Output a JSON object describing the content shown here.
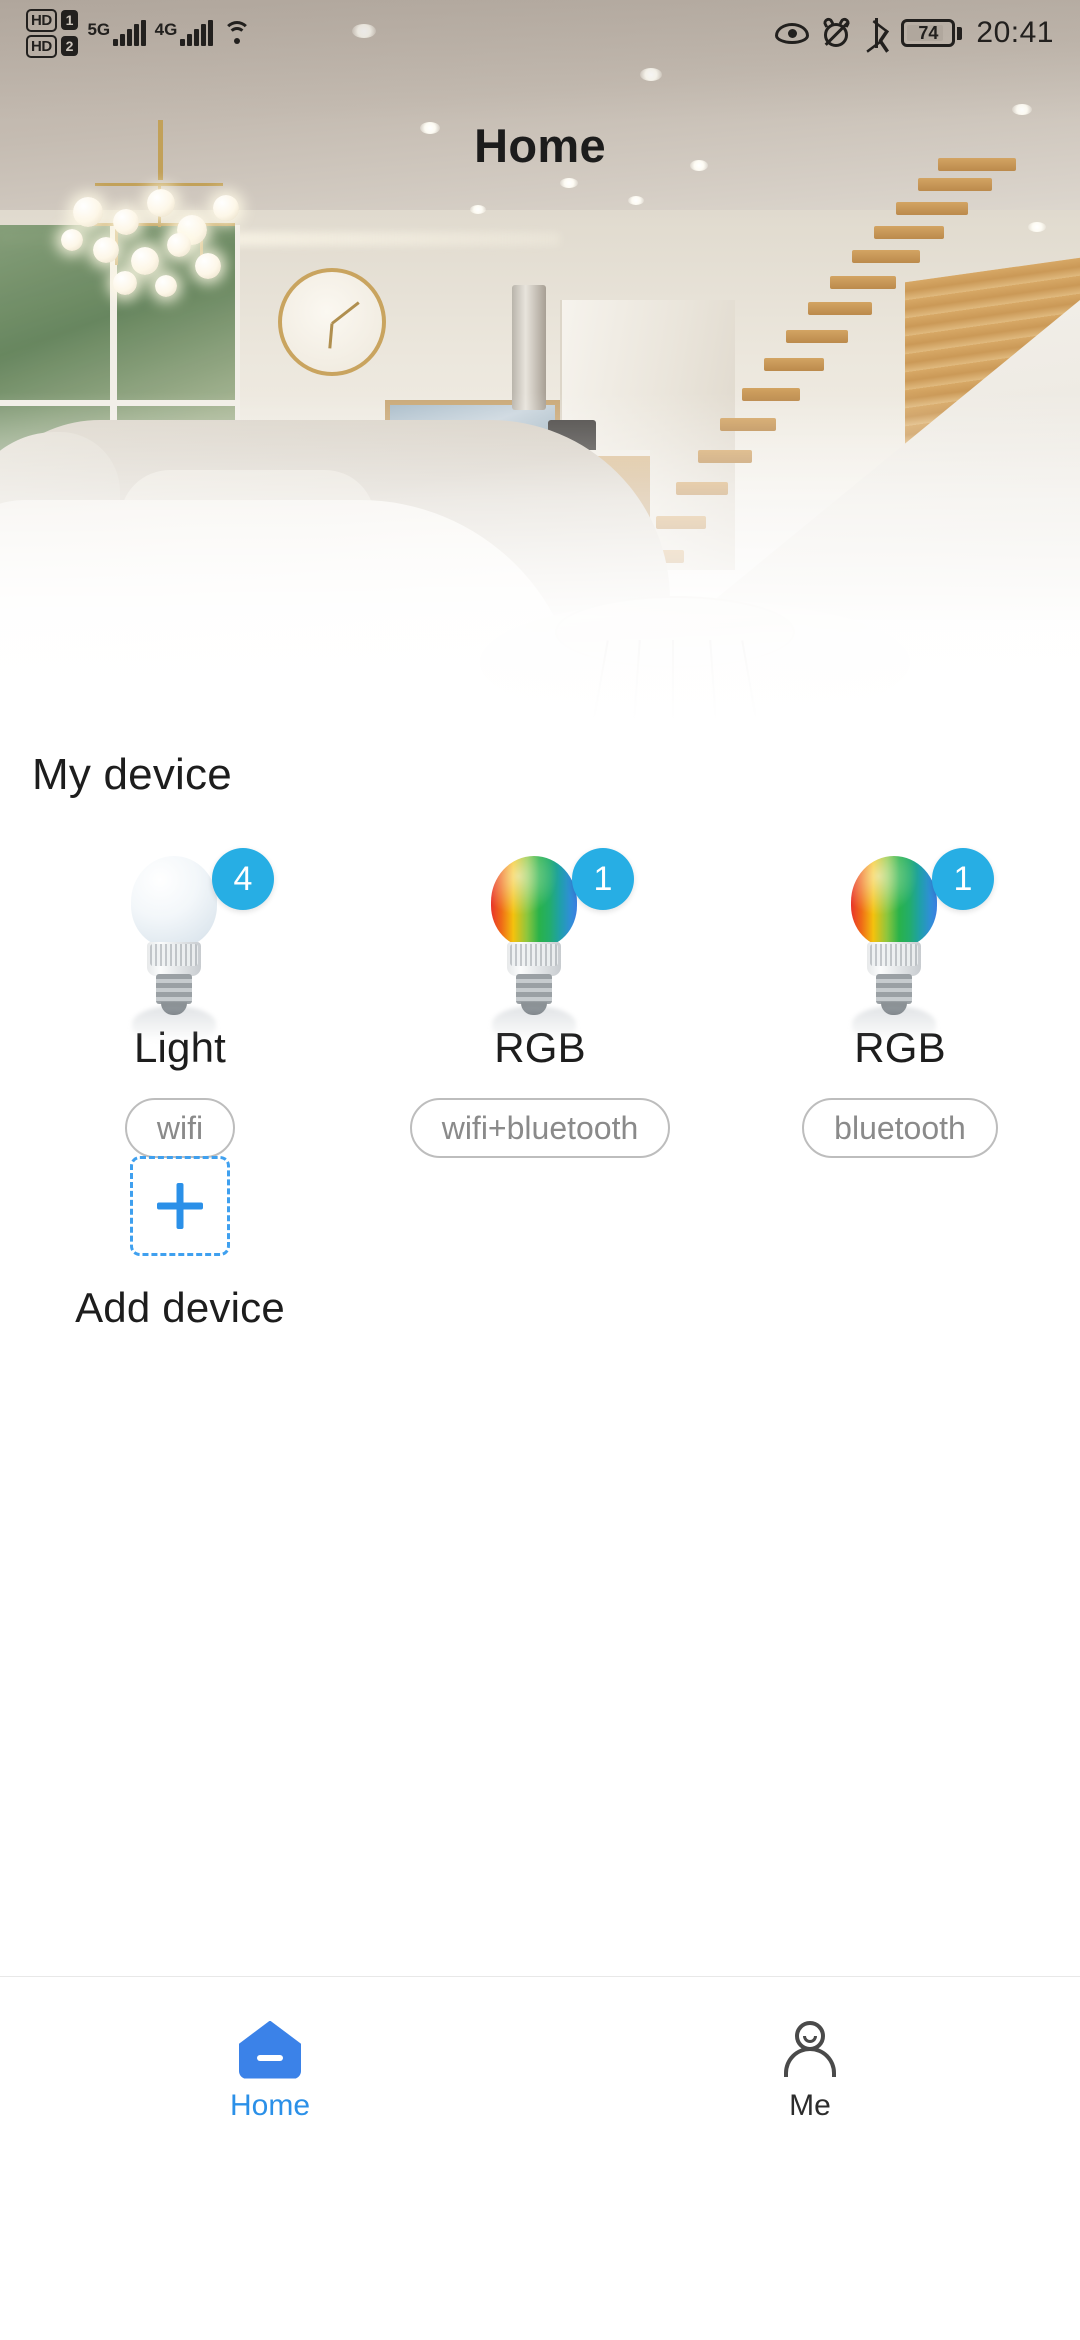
{
  "status_bar": {
    "hd_label_1": "HD",
    "sim_1": "1",
    "hd_label_2": "HD",
    "sim_2": "2",
    "network_1": "5G",
    "network_2": "4G",
    "wifi_icon": "wifi-icon",
    "eye_icon": "eye-comfort-icon",
    "alarm_icon": "alarm-muted-icon",
    "bluetooth_icon": "bluetooth-icon",
    "battery_level": "74",
    "time": "20:41"
  },
  "header": {
    "title": "Home",
    "hero_alt": "modern-living-room"
  },
  "main": {
    "section_title": "My device",
    "devices": [
      {
        "name": "Light",
        "badge": "4",
        "protocol": "wifi",
        "bulb_type": "white"
      },
      {
        "name": "RGB",
        "badge": "1",
        "protocol": "wifi+bluetooth",
        "bulb_type": "rgb"
      },
      {
        "name": "RGB",
        "badge": "1",
        "protocol": "bluetooth",
        "bulb_type": "rgb"
      }
    ],
    "add_device": {
      "label": "Add device",
      "icon": "plus-icon"
    }
  },
  "bottom_nav": {
    "items": [
      {
        "label": "Home",
        "icon": "home-icon",
        "active": true
      },
      {
        "label": "Me",
        "icon": "person-icon",
        "active": false
      }
    ]
  },
  "colors": {
    "accent_blue": "#2b90e8",
    "badge_blue": "#27aee4",
    "tag_border": "#bdbdbd",
    "tag_text": "#8a8a8a",
    "text_dark": "#1d1d1d"
  }
}
